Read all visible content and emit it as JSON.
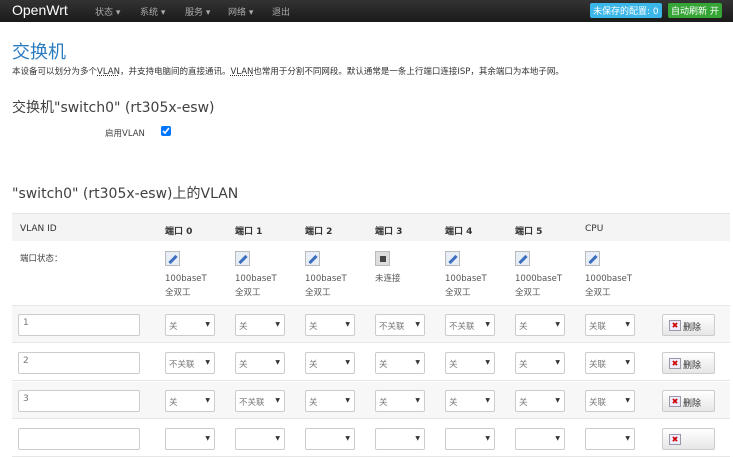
{
  "header": {
    "brand": "OpenWrt",
    "menu": [
      "状态 ▾",
      "系统 ▾",
      "服务 ▾",
      "网络 ▾",
      "退出"
    ],
    "unsaved": "未保存的配置: 0",
    "autorefresh": "自动刷新 开"
  },
  "page": {
    "title": "交换机",
    "desc_parts": [
      "本设备可以划分为多个",
      "VLAN",
      "，并支持电脑间的直接通讯。",
      "VLAN",
      "也常用于分割不同网段。默认通常是一条上行端口连接ISP，其余端口为本地子网。"
    ]
  },
  "switch": {
    "title": "交换机\"switch0\" (rt305x-esw)",
    "enable_vlan_label": "启用VLAN",
    "enable_vlan": true
  },
  "vlan": {
    "title": "\"switch0\" (rt305x-esw)上的VLAN",
    "columns": [
      "VLAN ID",
      "端口 0",
      "端口 1",
      "端口 2",
      "端口 3",
      "端口 4",
      "端口 5",
      "CPU"
    ],
    "status_label": "端口状态：",
    "ports": [
      {
        "speed": "100baseT",
        "duplex": "全双工",
        "up": true
      },
      {
        "speed": "100baseT",
        "duplex": "全双工",
        "up": true
      },
      {
        "speed": "100baseT",
        "duplex": "全双工",
        "up": true
      },
      {
        "speed": "未连接",
        "duplex": "",
        "up": false
      },
      {
        "speed": "100baseT",
        "duplex": "全双工",
        "up": true
      },
      {
        "speed": "1000baseT",
        "duplex": "全双工",
        "up": true
      },
      {
        "speed": "1000baseT",
        "duplex": "全双工",
        "up": true
      }
    ],
    "rows": [
      {
        "id": "1",
        "ports": [
          "关",
          "关",
          "关",
          "不关联",
          "不关联",
          "关",
          "关联"
        ]
      },
      {
        "id": "2",
        "ports": [
          "不关联",
          "关",
          "关",
          "关",
          "关",
          "关",
          "关联"
        ]
      },
      {
        "id": "3",
        "ports": [
          "关",
          "不关联",
          "关",
          "关",
          "关",
          "关",
          "关联"
        ]
      }
    ],
    "delete_label": "删除"
  }
}
